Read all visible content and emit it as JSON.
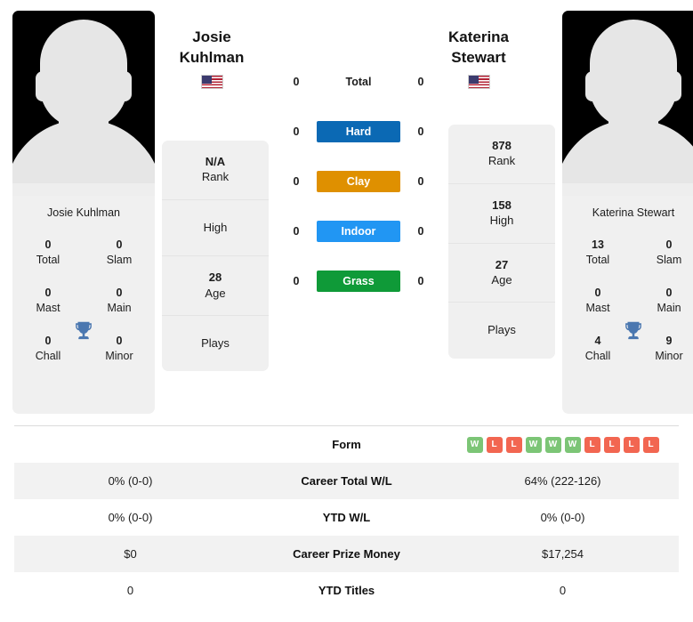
{
  "players": {
    "left": {
      "first_name": "Josie",
      "last_name": "Kuhlman",
      "flag": "us-flag-icon",
      "card_name": "Josie Kuhlman",
      "titles": [
        {
          "num": "0",
          "label": "Total"
        },
        {
          "num": "0",
          "label": "Slam"
        },
        {
          "num": "0",
          "label": "Mast"
        },
        {
          "num": "0",
          "label": "Main"
        },
        {
          "num": "0",
          "label": "Chall"
        },
        {
          "num": "0",
          "label": "Minor"
        }
      ],
      "stats": [
        {
          "num": "N/A",
          "label": "Rank"
        },
        {
          "num": "",
          "label": "High"
        },
        {
          "num": "28",
          "label": "Age"
        },
        {
          "num": "",
          "label": "Plays"
        }
      ]
    },
    "right": {
      "first_name": "Katerina",
      "last_name": "Stewart",
      "flag": "us-flag-icon",
      "card_name": "Katerina Stewart",
      "titles": [
        {
          "num": "13",
          "label": "Total"
        },
        {
          "num": "0",
          "label": "Slam"
        },
        {
          "num": "0",
          "label": "Mast"
        },
        {
          "num": "0",
          "label": "Main"
        },
        {
          "num": "4",
          "label": "Chall"
        },
        {
          "num": "9",
          "label": "Minor"
        }
      ],
      "stats": [
        {
          "num": "878",
          "label": "Rank"
        },
        {
          "num": "158",
          "label": "High"
        },
        {
          "num": "27",
          "label": "Age"
        },
        {
          "num": "",
          "label": "Plays"
        }
      ]
    }
  },
  "head_to_head": [
    {
      "left": "0",
      "label": "Total",
      "right": "0",
      "color": ""
    },
    {
      "left": "0",
      "label": "Hard",
      "right": "0",
      "color": "#0B69B4"
    },
    {
      "left": "0",
      "label": "Clay",
      "right": "0",
      "color": "#DF9000"
    },
    {
      "left": "0",
      "label": "Indoor",
      "right": "0",
      "color": "#2196F3"
    },
    {
      "left": "0",
      "label": "Grass",
      "right": "0",
      "color": "#0F9A38"
    }
  ],
  "table": {
    "form_row": {
      "label": "Form",
      "badges": [
        "W",
        "L",
        "L",
        "W",
        "W",
        "W",
        "L",
        "L",
        "L",
        "L"
      ],
      "win_color": "#7CC576",
      "loss_color": "#F26651"
    },
    "rows": [
      {
        "left": "0% (0-0)",
        "label": "Career Total W/L",
        "right": "64% (222-126)"
      },
      {
        "left": "0% (0-0)",
        "label": "YTD W/L",
        "right": "0% (0-0)"
      },
      {
        "left": "$0",
        "label": "Career Prize Money",
        "right": "$17,254"
      },
      {
        "left": "0",
        "label": "YTD Titles",
        "right": "0"
      }
    ]
  },
  "icons": {
    "trophy": "trophy-icon",
    "trophy_color": "#4A77B0"
  }
}
